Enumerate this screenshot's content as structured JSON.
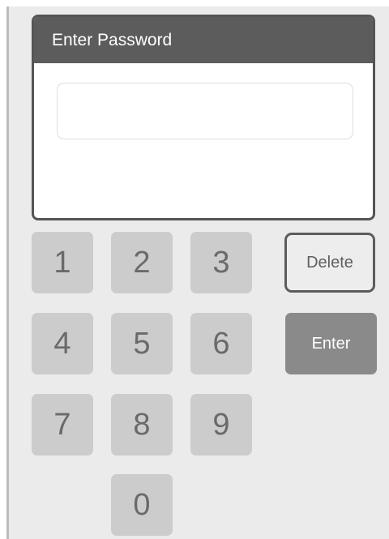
{
  "dialog": {
    "title": "Enter Password",
    "password": {
      "value": "",
      "placeholder": ""
    }
  },
  "keypad": {
    "keys": [
      "1",
      "2",
      "3",
      "4",
      "5",
      "6",
      "7",
      "8",
      "9",
      "0"
    ],
    "delete_label": "Delete",
    "enter_label": "Enter"
  },
  "colors": {
    "header_bg": "#5c5c5c",
    "key_bg": "#cccccc",
    "enter_bg": "#8a8a8a",
    "screen_bg": "#ebebeb"
  }
}
